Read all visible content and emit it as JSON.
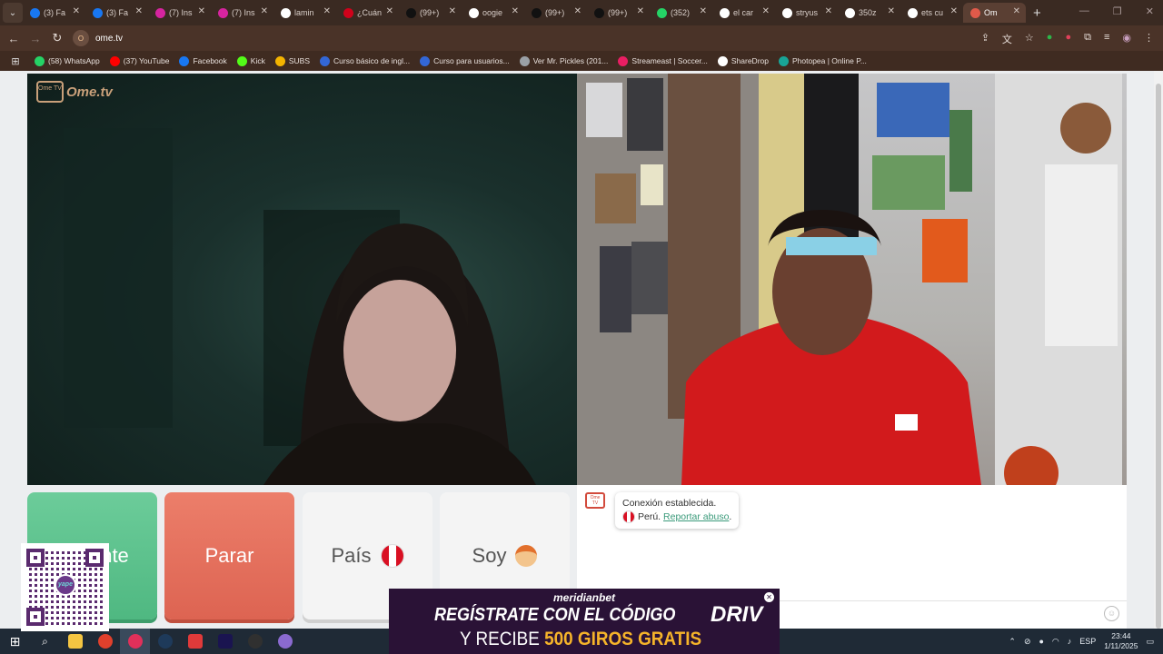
{
  "browser": {
    "tabs": [
      {
        "title": "(3) Fa",
        "color": "#1877f2"
      },
      {
        "title": "(3) Fa",
        "color": "#1877f2"
      },
      {
        "title": "(7) Ins",
        "color": "#d6249f"
      },
      {
        "title": "(7) Ins",
        "color": "#d6249f"
      },
      {
        "title": "lamin",
        "color": "#ffffff"
      },
      {
        "title": "¿Cuán",
        "color": "#d0021b"
      },
      {
        "title": "(99+)",
        "color": "#111111"
      },
      {
        "title": "oogie",
        "color": "#ffffff"
      },
      {
        "title": "(99+)",
        "color": "#111111"
      },
      {
        "title": "(99+)",
        "color": "#111111"
      },
      {
        "title": "(352)",
        "color": "#25d366"
      },
      {
        "title": "el car",
        "color": "#ffffff"
      },
      {
        "title": "stryus",
        "color": "#ffffff"
      },
      {
        "title": "350z",
        "color": "#ffffff"
      },
      {
        "title": "ets cu",
        "color": "#ffffff"
      },
      {
        "title": "Om",
        "color": "#e05a4a",
        "active": true
      }
    ],
    "url": "ome.tv",
    "site_icon_text": "O",
    "bookmarks": [
      {
        "label": "(58) WhatsApp",
        "color": "#25d366"
      },
      {
        "label": "(37) YouTube",
        "color": "#ff0000"
      },
      {
        "label": "Facebook",
        "color": "#1877f2"
      },
      {
        "label": "Kick",
        "color": "#53fc18"
      },
      {
        "label": "SUBS",
        "color": "#f4b400"
      },
      {
        "label": "Curso básico de ingl...",
        "color": "#3367d6"
      },
      {
        "label": "Curso para usuarios...",
        "color": "#3367d6"
      },
      {
        "label": "Ver Mr. Pickles (201...",
        "color": "#9aa0a6"
      },
      {
        "label": "Streameast | Soccer...",
        "color": "#e91e63"
      },
      {
        "label": "ShareDrop",
        "color": "#ffffff"
      },
      {
        "label": "Photopea | Online P...",
        "color": "#18a497"
      }
    ]
  },
  "ometv": {
    "logo_text": "Ome.tv",
    "logo_tv_text": "Ome TV",
    "buttons": {
      "next": "nte",
      "stop": "Parar",
      "country": "País",
      "gender": "Soy"
    },
    "chat": {
      "status": "Conexión establecida.",
      "country": "Perú.",
      "report_link": "Reportar abuso",
      "report_suffix": "."
    }
  },
  "overlays": {
    "qr_logo": "yape",
    "ad": {
      "brand": "meridianbet",
      "line1": "REGÍSTRATE CON EL CÓDIGO",
      "code": "DRIV",
      "line2_prefix": "Y RECIBE ",
      "line2_highlight": "500 GIROS GRATIS"
    }
  },
  "taskbar": {
    "language": "ESP",
    "time": "23:44",
    "date": "1/11/2025"
  }
}
